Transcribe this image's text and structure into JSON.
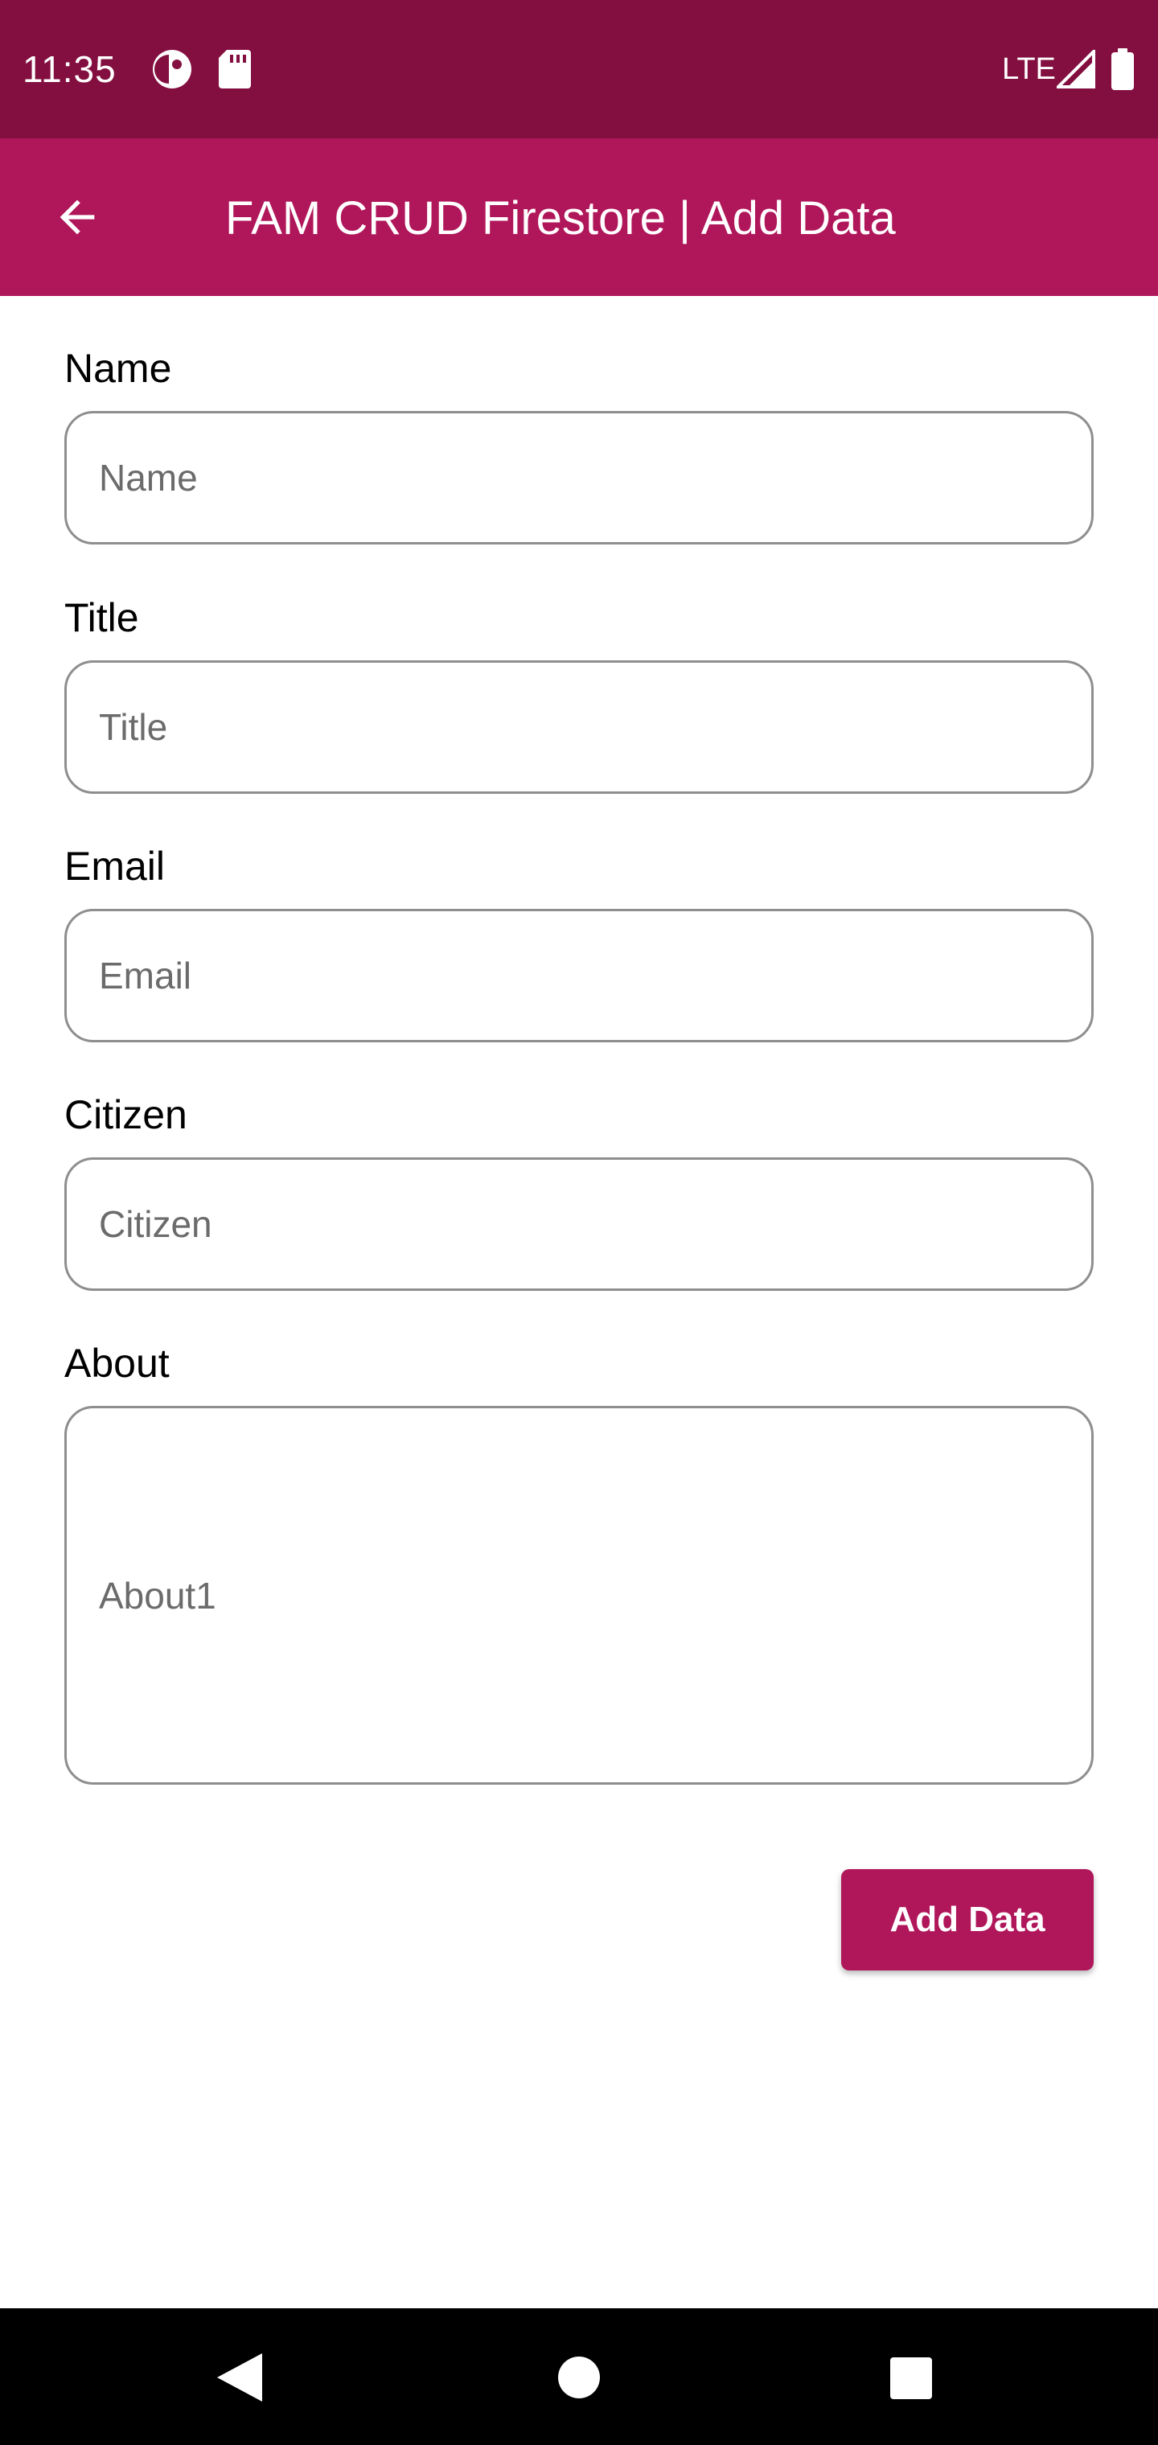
{
  "status_bar": {
    "time": "11:35",
    "network": "LTE",
    "background_color": "#830f40",
    "icons": [
      "notification-app-icon",
      "sd-card-icon",
      "signal-icon",
      "battery-icon"
    ]
  },
  "app_bar": {
    "title": "FAM CRUD Firestore | Add Data",
    "background_color": "#b0165a",
    "back_icon": "arrow-back-icon"
  },
  "form": {
    "name": {
      "label": "Name",
      "placeholder": "Name",
      "value": ""
    },
    "title": {
      "label": "Title",
      "placeholder": "Title",
      "value": ""
    },
    "email": {
      "label": "Email",
      "placeholder": "Email",
      "value": ""
    },
    "citizen": {
      "label": "Citizen",
      "placeholder": "Citizen",
      "value": ""
    },
    "about": {
      "label": "About",
      "placeholder": "About1",
      "value": ""
    }
  },
  "actions": {
    "add_data_label": "Add Data",
    "button_color": "#b0165a"
  },
  "nav_bar": {
    "icons": [
      "nav-back-icon",
      "nav-home-icon",
      "nav-recents-icon"
    ]
  }
}
